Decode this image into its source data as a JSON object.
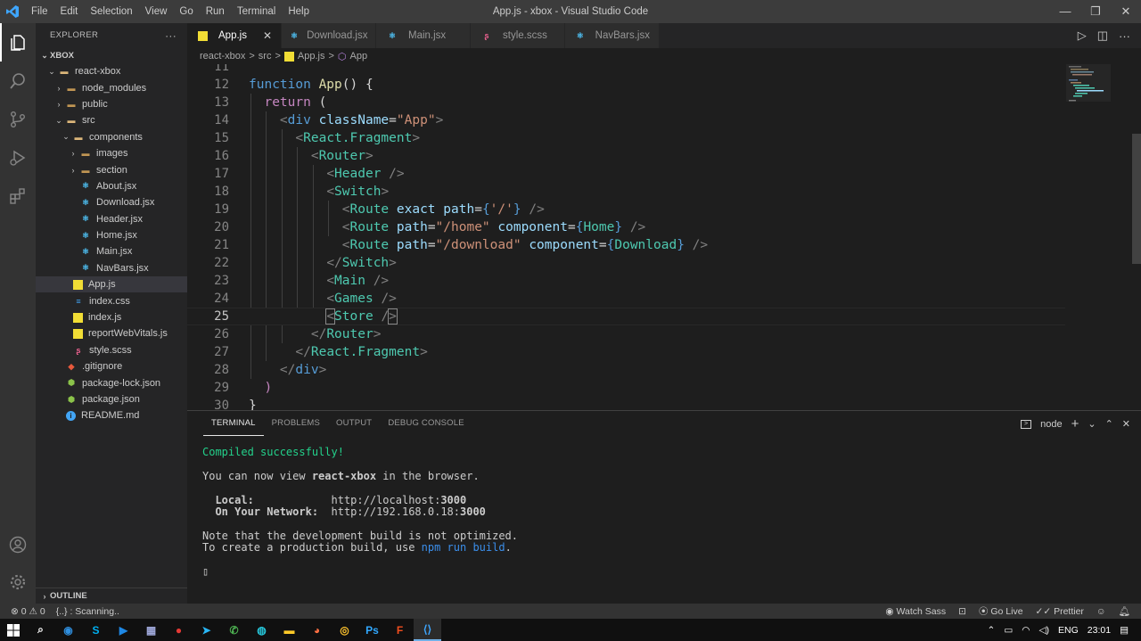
{
  "window": {
    "title": "App.js - xbox - Visual Studio Code",
    "menu": [
      "File",
      "Edit",
      "Selection",
      "View",
      "Go",
      "Run",
      "Terminal",
      "Help"
    ]
  },
  "sidebar": {
    "header": "EXPLORER",
    "more": "···",
    "workspace": "XBOX",
    "tree": [
      {
        "label": "react-xbox",
        "icon": "folder-open-icon",
        "depth": 0
      },
      {
        "label": "node_modules",
        "icon": "folder-icon",
        "depth": 1
      },
      {
        "label": "public",
        "icon": "folder-icon",
        "depth": 1
      },
      {
        "label": "src",
        "icon": "folder-open-icon",
        "depth": 1
      },
      {
        "label": "components",
        "icon": "folder-open-icon",
        "depth": 2
      },
      {
        "label": "images",
        "icon": "folder-icon",
        "depth": 3
      },
      {
        "label": "section",
        "icon": "folder-icon",
        "depth": 3
      },
      {
        "label": "About.jsx",
        "icon": "react-icon",
        "depth": 3
      },
      {
        "label": "Download.jsx",
        "icon": "react-icon",
        "depth": 3
      },
      {
        "label": "Header.jsx",
        "icon": "react-icon",
        "depth": 3
      },
      {
        "label": "Home.jsx",
        "icon": "react-icon",
        "depth": 3
      },
      {
        "label": "Main.jsx",
        "icon": "react-icon",
        "depth": 3
      },
      {
        "label": "NavBars.jsx",
        "icon": "react-icon",
        "depth": 3
      },
      {
        "label": "App.js",
        "icon": "js-icon",
        "depth": 2,
        "selected": true
      },
      {
        "label": "index.css",
        "icon": "css-icon",
        "depth": 2
      },
      {
        "label": "index.js",
        "icon": "js-icon",
        "depth": 2
      },
      {
        "label": "reportWebVitals.js",
        "icon": "js-icon",
        "depth": 2
      },
      {
        "label": "style.scss",
        "icon": "sass-icon",
        "depth": 2
      },
      {
        "label": ".gitignore",
        "icon": "git-icon",
        "depth": 1
      },
      {
        "label": "package-lock.json",
        "icon": "npm-icon",
        "depth": 1
      },
      {
        "label": "package.json",
        "icon": "npm-icon",
        "depth": 1
      },
      {
        "label": "README.md",
        "icon": "info-icon",
        "depth": 1
      }
    ],
    "outline": "OUTLINE"
  },
  "tabs": [
    {
      "label": "App.js",
      "icon": "js-icon",
      "active": true
    },
    {
      "label": "Download.jsx",
      "icon": "react-icon"
    },
    {
      "label": "Main.jsx",
      "icon": "react-icon"
    },
    {
      "label": "style.scss",
      "icon": "sass-icon"
    },
    {
      "label": "NavBars.jsx",
      "icon": "react-icon"
    }
  ],
  "breadcrumb": {
    "root": "react-xbox",
    "folder": "src",
    "file": "App.js",
    "symbol": "App",
    "sep": ">"
  },
  "editor": {
    "current_line": 25,
    "lines": [
      {
        "n": "11",
        "html": ""
      },
      {
        "n": "12",
        "html": "<span class='kw'>function</span> <span class='fn'>App</span>() {"
      },
      {
        "n": "13",
        "html": "  <span class='ctl'>return</span> ("
      },
      {
        "n": "14",
        "html": "    <span class='brk'>&lt;</span><span class='kw'>div</span> <span class='attr'>className</span>=<span class='str'>\"App\"</span><span class='brk'>&gt;</span>"
      },
      {
        "n": "15",
        "html": "      <span class='brk'>&lt;</span><span class='tag'>React.Fragment</span><span class='brk'>&gt;</span>"
      },
      {
        "n": "16",
        "html": "        <span class='brk'>&lt;</span><span class='tag'>Router</span><span class='brk'>&gt;</span>"
      },
      {
        "n": "17",
        "html": "          <span class='brk'>&lt;</span><span class='tag'>Header</span> <span class='brk'>/&gt;</span>"
      },
      {
        "n": "18",
        "html": "          <span class='brk'>&lt;</span><span class='tag'>Switch</span><span class='brk'>&gt;</span>"
      },
      {
        "n": "19",
        "html": "            <span class='brk'>&lt;</span><span class='tag'>Route</span> <span class='attr'>exact</span> <span class='attr'>path</span>=<span class='kw'>{</span><span class='str'>'/'</span><span class='kw'>}</span> <span class='brk'>/&gt;</span>"
      },
      {
        "n": "20",
        "html": "            <span class='brk'>&lt;</span><span class='tag'>Route</span> <span class='attr'>path</span>=<span class='str'>\"/home\"</span> <span class='attr'>component</span>=<span class='kw'>{</span><span class='tag'>Home</span><span class='kw'>}</span> <span class='brk'>/&gt;</span>"
      },
      {
        "n": "21",
        "html": "            <span class='brk'>&lt;</span><span class='tag'>Route</span> <span class='attr'>path</span>=<span class='str'>\"/download\"</span> <span class='attr'>component</span>=<span class='kw'>{</span><span class='tag'>Download</span><span class='kw'>}</span> <span class='brk'>/&gt;</span>"
      },
      {
        "n": "22",
        "html": "          <span class='brk'>&lt;/</span><span class='tag'>Switch</span><span class='brk'>&gt;</span>"
      },
      {
        "n": "23",
        "html": "          <span class='brk'>&lt;</span><span class='tag'>Main</span> <span class='brk'>/&gt;</span>"
      },
      {
        "n": "24",
        "html": "          <span class='brk'>&lt;</span><span class='tag'>Games</span> <span class='brk'>/&gt;</span>"
      },
      {
        "n": "25",
        "html": "          <span class='brk' style='outline:1px solid #888'>&lt;</span><span class='tag'>Store</span> <span class='brk'>/</span><span class='brk' style='outline:1px solid #888'>&gt;</span>"
      },
      {
        "n": "26",
        "html": "        <span class='brk'>&lt;/</span><span class='tag'>Router</span><span class='brk'>&gt;</span>"
      },
      {
        "n": "27",
        "html": "      <span class='brk'>&lt;/</span><span class='tag'>React.Fragment</span><span class='brk'>&gt;</span>"
      },
      {
        "n": "28",
        "html": "    <span class='brk'>&lt;/</span><span class='kw'>div</span><span class='brk'>&gt;</span>"
      },
      {
        "n": "29",
        "html": "  <span class='ctl'>)</span>"
      },
      {
        "n": "30",
        "html": "}"
      }
    ]
  },
  "panel": {
    "tabs": [
      "TERMINAL",
      "PROBLEMS",
      "OUTPUT",
      "DEBUG CONSOLE"
    ],
    "active_tab": "TERMINAL",
    "shell": "node",
    "terminal_lines": [
      {
        "html": "<span class='green'>Compiled successfully!</span>"
      },
      {
        "html": ""
      },
      {
        "html": "You can now view <b>react-xbox</b> in the browser."
      },
      {
        "html": ""
      },
      {
        "html": "  <b>Local:</b>            http://localhost:<b>3000</b>"
      },
      {
        "html": "  <b>On Your Network:</b>  http://192.168.0.18:<b>3000</b>"
      },
      {
        "html": ""
      },
      {
        "html": "Note that the development build is not optimized."
      },
      {
        "html": "To create a production build, use <span class='link'>npm run build</span>."
      },
      {
        "html": ""
      },
      {
        "html": "▯"
      }
    ]
  },
  "statusbar": {
    "errors": "0",
    "warnings": "0",
    "scanning": "{..} : Scanning..",
    "watch_sass": "Watch Sass",
    "go_live": "Go Live",
    "prettier": "Prettier"
  },
  "taskbar": {
    "apps": [
      "search-icon",
      "edge-icon",
      "skype-icon",
      "media-icon",
      "calculator-icon",
      "record-icon",
      "telegram-icon",
      "whatsapp-icon",
      "app-icon",
      "files-icon",
      "firefox-icon",
      "chrome-icon",
      "photoshop-icon",
      "figma-icon",
      "vscode-icon"
    ],
    "lang": "ENG",
    "time": "23:01"
  },
  "colors": {
    "accent": "#007acc",
    "title_bg": "#3c3c3c",
    "editor_bg": "#1e1e1e",
    "sidebar_bg": "#252526"
  }
}
